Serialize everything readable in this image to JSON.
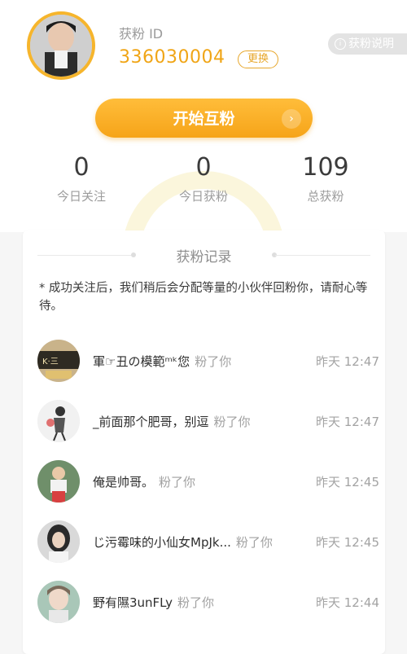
{
  "header": {
    "fan_id_label": "获粉 ID",
    "fan_id_value": "336030004",
    "change_button": "更换",
    "help_label": "获粉说明",
    "help_icon": "info-icon",
    "start_button": "开始互粉",
    "start_arrow_icon": "chevron-right-icon"
  },
  "stats": [
    {
      "value": "0",
      "label": "今日关注"
    },
    {
      "value": "0",
      "label": "今日获粉"
    },
    {
      "value": "109",
      "label": "总获粉"
    }
  ],
  "records": {
    "title": "获粉记录",
    "notice": "* 成功关注后，我们稍后会分配等量的小伙伴回粉你，请耐心等待。",
    "items": [
      {
        "name": "軍☞丑の模範ᵐᵏ您",
        "action": "粉了你",
        "time": "昨天 12:47"
      },
      {
        "name": "_前面那个肥哥，别逗",
        "action": "粉了你",
        "time": "昨天 12:47"
      },
      {
        "name": "俺是帅哥。",
        "action": "粉了你",
        "time": "昨天 12:45"
      },
      {
        "name": "じ污霉味的小仙女MpJk...",
        "action": "粉了你",
        "time": "昨天 12:45"
      },
      {
        "name": "野有隰3unFLy",
        "action": "粉了你",
        "time": "昨天 12:44"
      }
    ]
  },
  "colors": {
    "accent": "#f6a419",
    "accent_text": "#f0a516",
    "muted": "#9c9c9c"
  }
}
